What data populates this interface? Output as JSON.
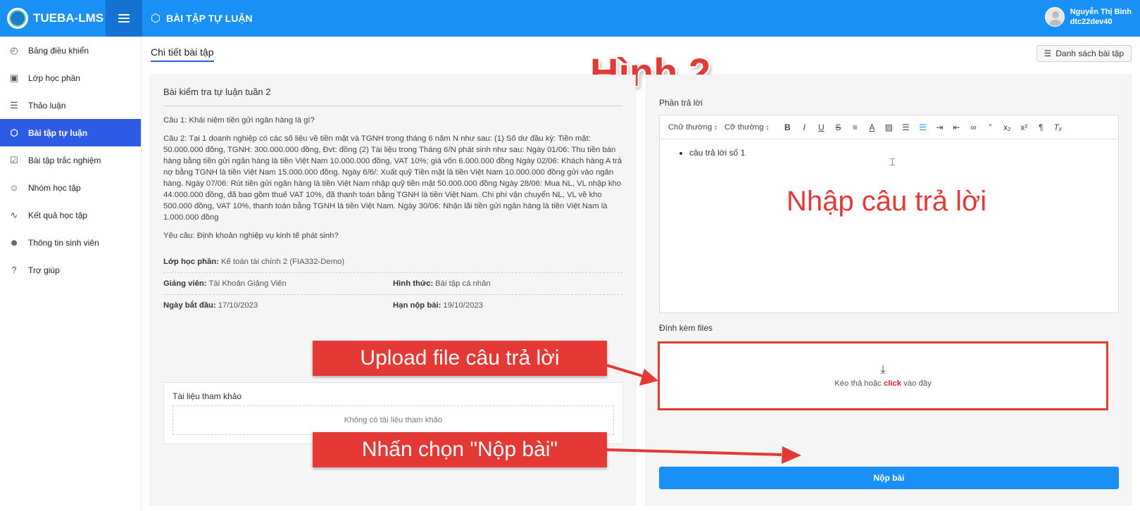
{
  "header": {
    "brand": "TUEBA-LMS",
    "page_title": "BÀI TẬP TỰ LUẬN",
    "user_name": "Nguyễn Thị Bình",
    "user_id": "dtc22dev40",
    "bar_color": "#1890f5"
  },
  "sidebar": {
    "items": [
      {
        "label": "Bảng điều khiển",
        "icon": "dashboard-icon"
      },
      {
        "label": "Lớp học phần",
        "icon": "briefcase-icon"
      },
      {
        "label": "Thảo luận",
        "icon": "chat-icon"
      },
      {
        "label": "Bài tập tự luận",
        "icon": "network-icon",
        "active": true
      },
      {
        "label": "Bài tập trắc nghiệm",
        "icon": "checkbox-icon"
      },
      {
        "label": "Nhóm học tập",
        "icon": "group-icon"
      },
      {
        "label": "Kết quả học tập",
        "icon": "chart-icon"
      },
      {
        "label": "Thông tin sinh viên",
        "icon": "user-icon"
      },
      {
        "label": "Trợ giúp",
        "icon": "help-icon"
      }
    ],
    "active_color": "#2d5be3"
  },
  "main": {
    "breadcrumb": "Chi tiết bài tập",
    "list_button": "Danh sách bài tập",
    "figure_label": "Hình 2"
  },
  "assignment": {
    "title": "Bài kiểm tra tự luận tuần 2",
    "q1": "Câu 1: Khái niệm tiền gửi ngân hàng là gì?",
    "q2": "Câu 2: Tại 1 doanh nghiệp có các số liệu về tiền mặt và TGNH trong tháng 6 năm N như sau: (1) Số dư đầu kỳ: Tiền mặt: 50.000.000 đồng, TGNH: 300.000.000 đồng, Đvt: đồng (2) Tài liệu trong Tháng 6/N phát sinh như sau: Ngày 01/06: Thu tiền bán hàng bằng tiền gửi ngân hàng là tiền Việt Nam 10.000.000 đồng, VAT 10%; giá vốn 6.000.000 đồng Ngày 02/06: Khách hàng A trả nợ bằng TGNH là tiền Việt Nam 15.000.000 đồng. Ngày 6/6/: Xuất quỹ Tiền mặt là tiền Việt Nam 10.000.000 đồng gửi vào ngân hàng. Ngày 07/06: Rút tiền gửi ngân hàng là tiền Việt Nam nhập quỹ tiền mặt 50.000.000 đồng Ngày 28/06: Mua NL, VL nhập kho 44.000.000 đồng, đã bao gồm thuế VAT 10%, đã thanh toán bằng TGNH là tiền Việt Nam. Chi phí vận chuyển NL, VL về kho 500.000 đồng, VAT 10%, thanh toán bằng TGNH là tiền Việt Nam. Ngày 30/06: Nhận lãi tiền gửi ngân hàng là tiền Việt Nam là 1.000.000 đồng",
    "requirement": "Yêu cầu: Định khoản nghiệp vụ kinh tế phát sinh?",
    "class_label": "Lớp học phần:",
    "class_value": "Kế toán tài chính 2 (FIA332-Demo)",
    "teacher_label": "Giảng viên:",
    "teacher_value": "Tài Khoản Giảng Viên",
    "form_label": "Hình thức:",
    "form_value": "Bài tập cá nhân",
    "start_label": "Ngày bắt đầu:",
    "start_value": "17/10/2023",
    "deadline_label": "Hạn nộp bài:",
    "deadline_value": "19/10/2023",
    "ref_title": "Tài liệu tham khảo",
    "ref_empty": "Không có tài liệu tham khảo"
  },
  "answer": {
    "label": "Phần trả lời",
    "font_style": "Chữ thường",
    "font_size": "Cỡ thường",
    "content_item": "câu trả lời số 1",
    "hint": "Nhập câu trả lời",
    "attach_label": "Đính kèm files",
    "drop_prefix": "Kéo thả hoặc",
    "drop_click": "click",
    "drop_suffix": "vào đây",
    "submit": "Nộp bài"
  },
  "annotations": {
    "upload": "Upload file câu trả lời",
    "submit": "Nhấn chọn \"Nộp bài\"",
    "color": "#e53935"
  }
}
